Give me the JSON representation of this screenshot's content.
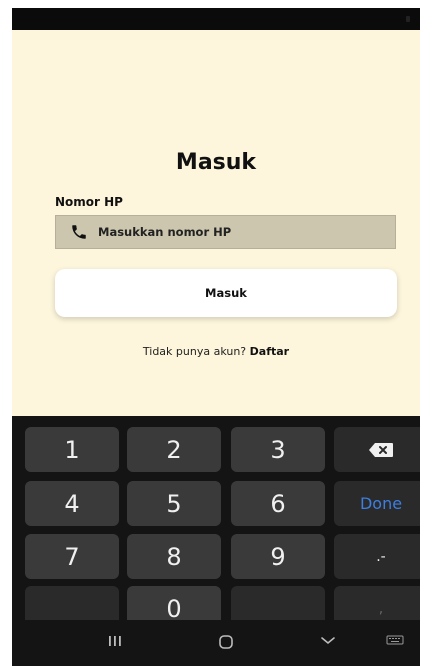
{
  "login": {
    "title": "Masuk",
    "phone_label": "Nomor HP",
    "phone_placeholder": "Masukkan nomor HP",
    "button_label": "Masuk",
    "no_account_text": "Tidak punya akun?",
    "register_link": "Daftar"
  },
  "keyboard": {
    "row1": [
      "1",
      "2",
      "3"
    ],
    "row2": [
      "4",
      "5",
      "6"
    ],
    "done_label": "Done",
    "row3": [
      "7",
      "8",
      "9"
    ],
    "row3_extra": ".-",
    "zero": "0",
    "comma": ","
  },
  "colors": {
    "background": "#fdf6dc",
    "input_bg": "#cbc6ad",
    "done_blue": "#3d7ee0"
  },
  "icons": {
    "phone": "phone-icon",
    "backspace": "backspace-icon",
    "nav_recent": "recent-apps-icon",
    "nav_home": "home-icon",
    "nav_back": "back-chevron-icon",
    "nav_keyboard": "keyboard-icon"
  }
}
